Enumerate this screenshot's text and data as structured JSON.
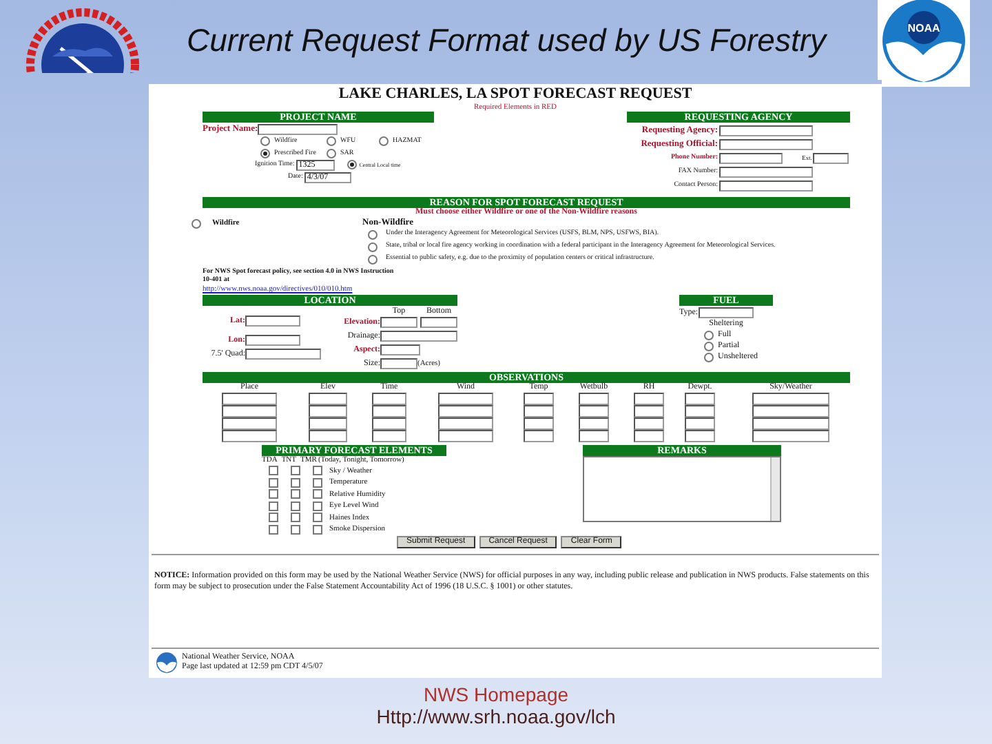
{
  "slide": {
    "title": "Current Request Format used by US Forestry",
    "noaa_logo_text": "NOAA",
    "footer_link": "NWS Homepage",
    "footer_url": "Http://www.srh.noaa.gov/lch"
  },
  "form": {
    "title": "LAKE CHARLES, LA SPOT FORECAST REQUEST",
    "subtitle": "Required Elements in RED",
    "project": {
      "header": "PROJECT NAME",
      "name_label": "Project Name:",
      "types": [
        {
          "label": "Wildfire",
          "selected": false
        },
        {
          "label": "WFU",
          "selected": false
        },
        {
          "label": "HAZMAT",
          "selected": false
        },
        {
          "label": "Prescribed Fire",
          "selected": true
        },
        {
          "label": "SAR",
          "selected": false
        }
      ],
      "ignition_label": "Ignition Time:",
      "ignition_value": "1325",
      "time_zone": {
        "label": "Central Local time",
        "selected": true
      },
      "date_label": "Date:",
      "date_value": "4/3/07"
    },
    "agency": {
      "header": "REQUESTING AGENCY",
      "fields": [
        {
          "label": "Requesting Agency:",
          "required": true
        },
        {
          "label": "Requesting Official:",
          "required": true
        },
        {
          "label": "Phone Number:",
          "required": true,
          "ext_label": "Ext."
        },
        {
          "label": "FAX Number:",
          "required": false
        },
        {
          "label": "Contact Person:",
          "required": false
        }
      ]
    },
    "reason": {
      "header": "REASON FOR SPOT FORECAST REQUEST",
      "note": "Must choose either Wildfire or one of the Non-Wildfire reasons",
      "wildfire": {
        "label": "Wildfire",
        "selected": false
      },
      "non_wildfire_heading": "Non-Wildfire",
      "options": [
        {
          "label": "Under the Interagency Agreement for Meteorological Services (USFS, BLM, NPS, USFWS, BIA).",
          "selected": false
        },
        {
          "label": "State, tribal or local fire agency working in coordination with a federal participant in the Interagency Agreement for Meteorological Services.",
          "selected": false
        },
        {
          "label": "Essential to public safety, e.g. due to the proximity of population centers or critical infrastructure.",
          "selected": false
        }
      ],
      "policy_note": "For NWS Spot forecast policy, see section 4.0 in NWS Instruction 10-401 at",
      "policy_link": "http://www.nws.noaa.gov/directives/010/010.htm"
    },
    "location": {
      "header": "LOCATION",
      "lat_label": "Lat:",
      "lon_label": "Lon:",
      "quad_label": "7.5' Quad:",
      "elevation_label": "Elevation:",
      "top_label": "Top",
      "bottom_label": "Bottom",
      "drainage_label": "Drainage:",
      "aspect_label": "Aspect:",
      "size_label": "Size:",
      "size_unit": "(Acres)"
    },
    "fuel": {
      "header": "FUEL",
      "type_label": "Type:",
      "sheltering_label": "Sheltering",
      "sheltering": [
        {
          "label": "Full",
          "selected": false
        },
        {
          "label": "Partial",
          "selected": false
        },
        {
          "label": "Unsheltered",
          "selected": false
        }
      ]
    },
    "observations": {
      "header": "OBSERVATIONS",
      "columns": [
        "Place",
        "Elev",
        "Time",
        "Wind",
        "Temp",
        "Wetbulb",
        "RH",
        "Dewpt.",
        "Sky/Weather"
      ]
    },
    "forecast_elements": {
      "header": "PRIMARY FORECAST ELEMENTS",
      "periods": [
        "TDA",
        "TNT",
        "TMR"
      ],
      "periods_note": "(Today, Tonight, Tomorrow)",
      "items": [
        {
          "label": "Sky / Weather",
          "checked": [
            false,
            false,
            false
          ]
        },
        {
          "label": "Temperature",
          "checked": [
            false,
            false,
            false
          ]
        },
        {
          "label": "Relative Humidity",
          "checked": [
            false,
            false,
            false
          ]
        },
        {
          "label": "Eye Level Wind",
          "checked": [
            false,
            false,
            false
          ]
        },
        {
          "label": "Haines Index",
          "checked": [
            false,
            false,
            false
          ]
        },
        {
          "label": "Smoke Dispersion",
          "checked": [
            false,
            false,
            false
          ]
        }
      ]
    },
    "remarks": {
      "header": "REMARKS"
    },
    "buttons": [
      "Submit Request",
      "Cancel Request",
      "Clear Form"
    ],
    "notice": "**NOTICE:**   Information provided on this form may be used by the National Weather Service (NWS) for official purposes in any way, including public release and publication in NWS products. False statements on this form may be subject to prosecution under the False Statement Accountability Act of 1996 (18 U.S.C. § 1001) or other statutes.",
    "footer": {
      "agency": "National Weather Service, NOAA",
      "updated": "Page last updated at 12:59 pm CDT 4/5/07"
    }
  }
}
